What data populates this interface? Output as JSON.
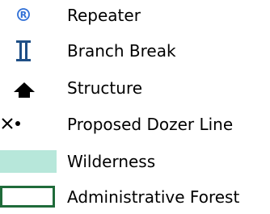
{
  "legend": {
    "items": [
      {
        "label": "Repeater",
        "symbol": "repeater-icon",
        "color": "#2f6fd6"
      },
      {
        "label": "Branch Break",
        "symbol": "branch-break-icon",
        "color": "#1f4f86"
      },
      {
        "label": "Structure",
        "symbol": "structure-icon",
        "color": "#000000"
      },
      {
        "label": "Proposed Dozer Line",
        "symbol": "proposed-dozer-line-icon",
        "color": "#000000"
      },
      {
        "label": "Wilderness",
        "symbol": "wilderness-swatch",
        "color": "#b7e7da"
      },
      {
        "label": "Administrative Forest",
        "symbol": "administrative-forest-swatch",
        "color": "#1f6b3a"
      }
    ]
  }
}
